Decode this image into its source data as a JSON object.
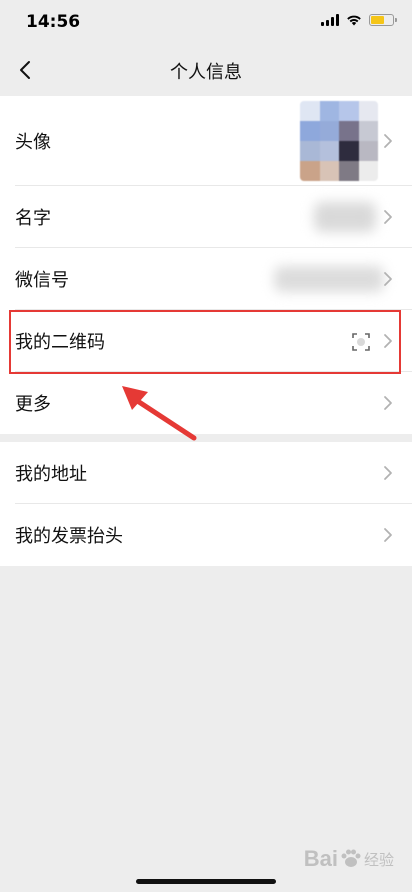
{
  "status_bar": {
    "time": "14:56"
  },
  "nav": {
    "title": "个人信息"
  },
  "rows_group1": [
    {
      "label": "头像"
    },
    {
      "label": "名字"
    },
    {
      "label": "微信号"
    },
    {
      "label": "我的二维码"
    },
    {
      "label": "更多"
    }
  ],
  "rows_group2": [
    {
      "label": "我的地址"
    },
    {
      "label": "我的发票抬头"
    }
  ],
  "watermark": {
    "text": "Bai",
    "suffix": "经验"
  },
  "colors": {
    "background": "#ededed",
    "highlight": "#e53935",
    "battery": "#f5c518"
  }
}
